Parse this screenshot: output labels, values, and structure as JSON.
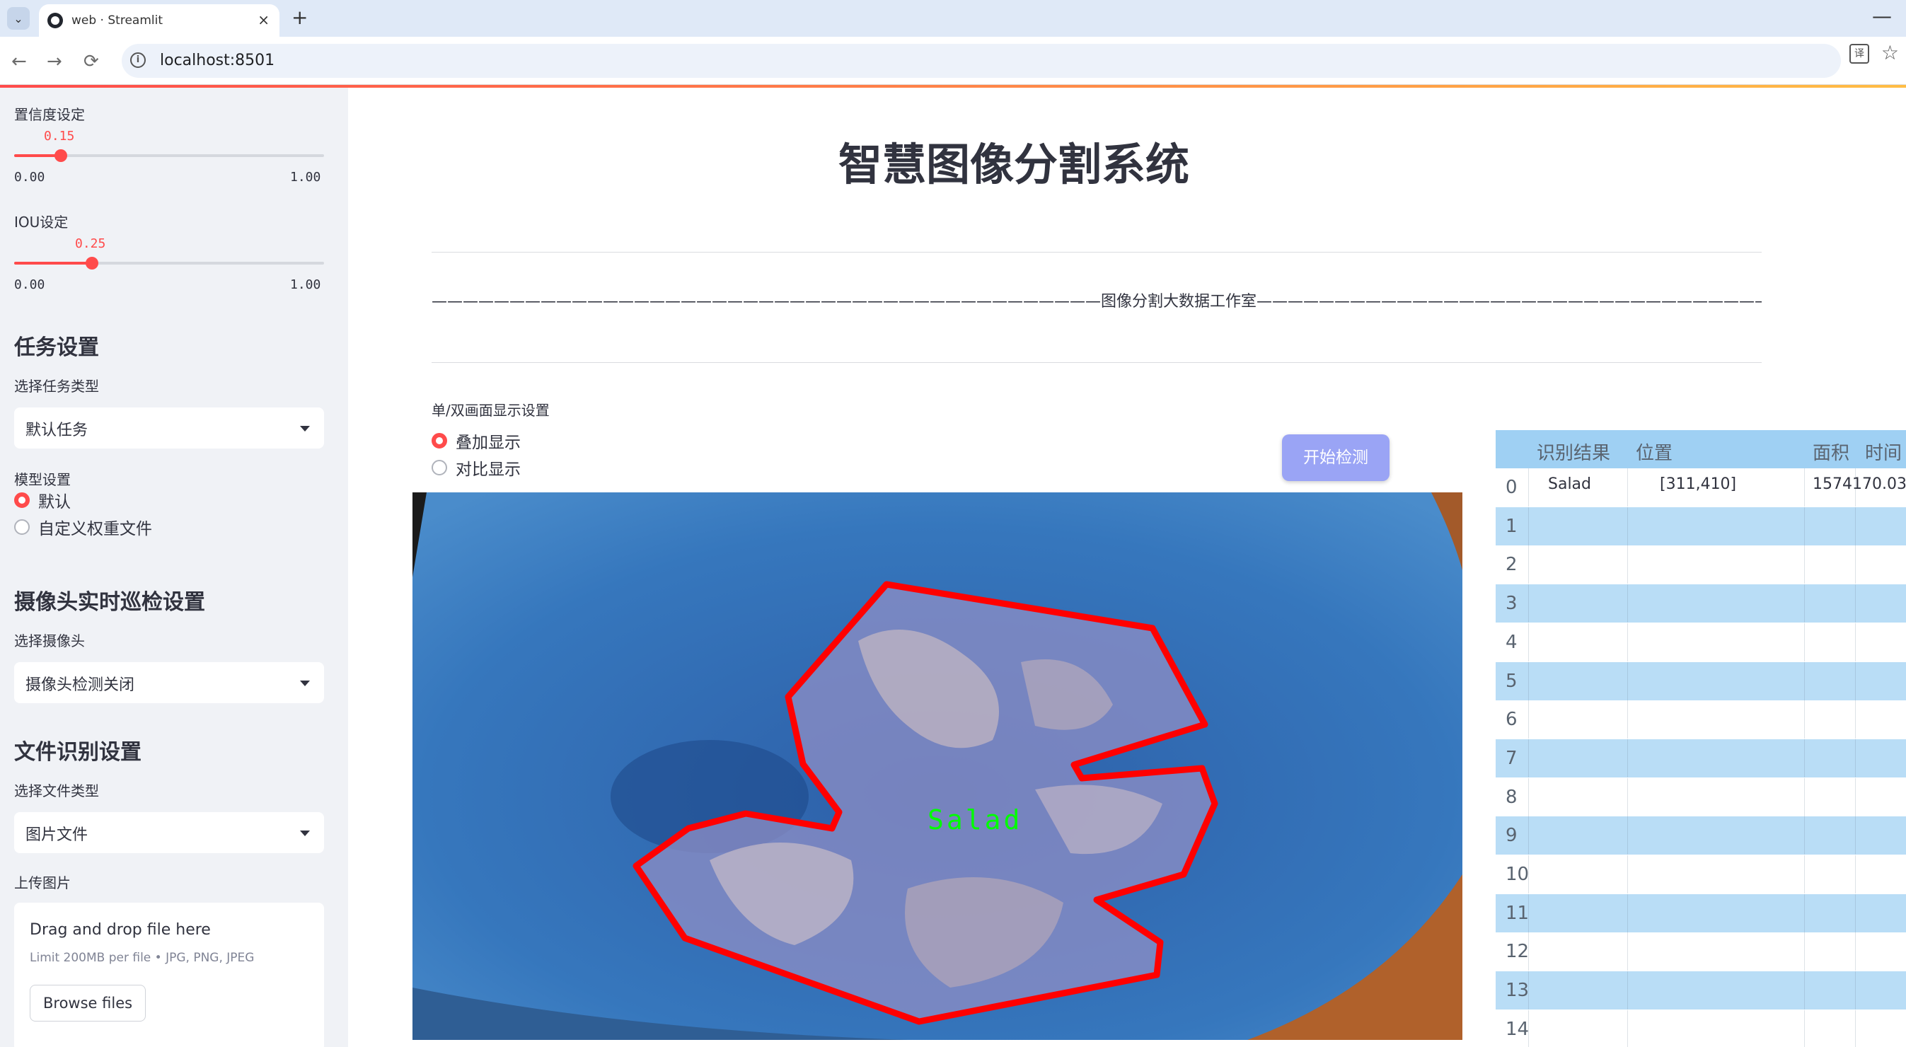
{
  "browser": {
    "tab_title": "web · Streamlit",
    "tab_close": "×",
    "new_tab": "+",
    "minimize": "—",
    "url": "localhost:8501",
    "back": "←",
    "forward": "→",
    "reload": "⟳",
    "info": "i",
    "translate": "译",
    "star": "☆",
    "tab_dropdown": "⌄"
  },
  "sidebar": {
    "confidence": {
      "label": "置信度设定",
      "value": "0.15",
      "fraction": 0.15,
      "min": "0.00",
      "max": "1.00"
    },
    "iou": {
      "label": "IOU设定",
      "value": "0.25",
      "fraction": 0.25,
      "min": "0.00",
      "max": "1.00"
    },
    "task_header": "任务设置",
    "task_type_label": "选择任务类型",
    "task_type_value": "默认任务",
    "model_label": "模型设置",
    "model_options": [
      "默认",
      "自定义权重文件"
    ],
    "model_selected": "默认",
    "camera_header": "摄像头实时巡检设置",
    "camera_label": "选择摄像头",
    "camera_value": "摄像头检测关闭",
    "file_header": "文件识别设置",
    "file_type_label": "选择文件类型",
    "file_type_value": "图片文件",
    "upload_label": "上传图片",
    "upload": {
      "drop_title": "Drag and drop file here",
      "limit": "Limit 200MB per file • JPG, PNG, JPEG",
      "browse": "Browse files"
    }
  },
  "main": {
    "title": "智慧图像分割系统",
    "subtitle": "———————————————————————————————————————————图像分割大数据工作室———————————————————————————————————————————",
    "display_label": "单/双画面显示设置",
    "display_options": [
      "叠加显示",
      "对比显示"
    ],
    "display_selected": "叠加显示",
    "start_button": "开始检测",
    "detection_label": "Salad"
  },
  "table": {
    "columns": [
      "识别结果",
      "位置",
      "面积",
      "时间"
    ],
    "rows": [
      {
        "index": "0",
        "result": "Salad",
        "position": "[311,410]",
        "area": "1574170.03",
        "time": ""
      },
      {
        "index": "1"
      },
      {
        "index": "2"
      },
      {
        "index": "3"
      },
      {
        "index": "4"
      },
      {
        "index": "5"
      },
      {
        "index": "6"
      },
      {
        "index": "7"
      },
      {
        "index": "8"
      },
      {
        "index": "9"
      },
      {
        "index": "10"
      },
      {
        "index": "11"
      },
      {
        "index": "12"
      },
      {
        "index": "13"
      },
      {
        "index": "14"
      }
    ]
  },
  "colors": {
    "accent": "#ff4b4b",
    "sidebar_bg": "#f0f2f6",
    "table_header": "#9fd0f3",
    "table_stripe": "#b9ddf6",
    "button": "#9aa4f5",
    "mask_outline": "#ff0000",
    "label_text": "#00ff00"
  }
}
